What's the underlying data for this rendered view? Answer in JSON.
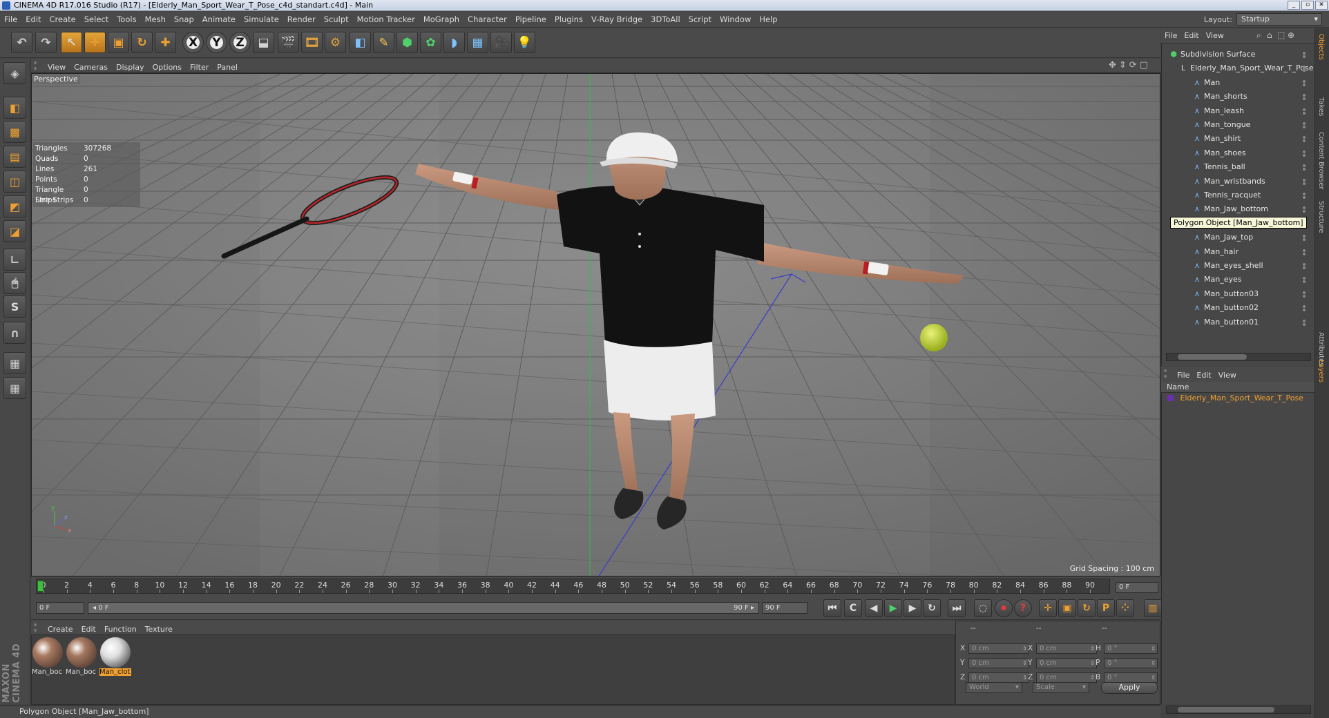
{
  "window": {
    "title": "CINEMA 4D R17.016 Studio (R17) - [Elderly_Man_Sport_Wear_T_Pose_c4d_standart.c4d] - Main",
    "controls": [
      "_",
      "▫",
      "✕"
    ]
  },
  "menu": [
    "File",
    "Edit",
    "Create",
    "Select",
    "Tools",
    "Mesh",
    "Snap",
    "Animate",
    "Simulate",
    "Render",
    "Sculpt",
    "Motion Tracker",
    "MoGraph",
    "Character",
    "Pipeline",
    "Plugins",
    "V-Ray Bridge",
    "3DToAll",
    "Script",
    "Window",
    "Help"
  ],
  "layout": {
    "label": "Layout:",
    "value": "Startup"
  },
  "toolbar": [
    {
      "name": "undo-icon",
      "glyph": "↶"
    },
    {
      "name": "redo-icon",
      "glyph": "↷"
    },
    {
      "name": "live-select-icon",
      "glyph": "↖",
      "active": true
    },
    {
      "name": "move-icon",
      "glyph": "✛",
      "active": true
    },
    {
      "name": "scale-icon",
      "glyph": "▣"
    },
    {
      "name": "rotate-icon",
      "glyph": "↻"
    },
    {
      "name": "last-tool-icon",
      "glyph": "✚"
    },
    {
      "name": "x-axis-icon",
      "glyph": "X"
    },
    {
      "name": "y-axis-icon",
      "glyph": "Y"
    },
    {
      "name": "z-axis-icon",
      "glyph": "Z"
    },
    {
      "name": "coordinate-system-icon",
      "glyph": "⬓"
    },
    {
      "name": "render-view-icon",
      "glyph": "🎬"
    },
    {
      "name": "render-picture-viewer-icon",
      "glyph": "🎞"
    },
    {
      "name": "render-settings-icon",
      "glyph": "⚙"
    },
    {
      "name": "cube-icon",
      "glyph": "◧"
    },
    {
      "name": "spline-pen-icon",
      "glyph": "✎"
    },
    {
      "name": "subdivision-icon",
      "glyph": "⬢"
    },
    {
      "name": "cloner-icon",
      "glyph": "✿"
    },
    {
      "name": "deformer-icon",
      "glyph": "◗"
    },
    {
      "name": "floor-icon",
      "glyph": "▦"
    },
    {
      "name": "camera-icon",
      "glyph": "🎥"
    },
    {
      "name": "light-icon",
      "glyph": "💡"
    }
  ],
  "lefttools": [
    {
      "name": "make-editable-icon",
      "glyph": "◈"
    },
    {
      "name": "model-mode-icon",
      "glyph": "◧"
    },
    {
      "name": "texture-mode-icon",
      "glyph": "▩"
    },
    {
      "name": "workplane-icon",
      "glyph": "▤"
    },
    {
      "name": "points-mode-icon",
      "glyph": "◫"
    },
    {
      "name": "edges-mode-icon",
      "glyph": "◩"
    },
    {
      "name": "polygons-mode-icon",
      "glyph": "◪"
    },
    {
      "name": "axis-mode-icon",
      "glyph": "∟"
    },
    {
      "name": "tweak-mode-icon",
      "glyph": "🖱"
    },
    {
      "name": "solo-icon",
      "glyph": "S"
    },
    {
      "name": "snap-icon",
      "glyph": "∩"
    },
    {
      "name": "workplane-lock-icon",
      "glyph": "▦"
    },
    {
      "name": "quantize-icon",
      "glyph": "▦"
    }
  ],
  "brand": "MAXON CINEMA 4D",
  "viewport": {
    "menu": [
      "View",
      "Cameras",
      "Display",
      "Options",
      "Filter",
      "Panel"
    ],
    "label": "Perspective",
    "stats": [
      {
        "k": "Triangles",
        "v": "307268"
      },
      {
        "k": "Quads",
        "v": "0"
      },
      {
        "k": "Lines",
        "v": "261"
      },
      {
        "k": "Points",
        "v": "0"
      },
      {
        "k": "Triangle Strips",
        "v": "0"
      },
      {
        "k": "Line Strips",
        "v": "0"
      }
    ],
    "grid_spacing": "Grid Spacing : 100 cm",
    "tooltip": "Polygon Object [Man_Jaw_bottom]"
  },
  "timeline": {
    "ticks": [
      "0",
      "2",
      "4",
      "6",
      "8",
      "10",
      "12",
      "14",
      "16",
      "18",
      "20",
      "22",
      "24",
      "26",
      "28",
      "30",
      "32",
      "34",
      "36",
      "38",
      "40",
      "42",
      "44",
      "46",
      "48",
      "50",
      "52",
      "54",
      "56",
      "58",
      "60",
      "62",
      "64",
      "66",
      "68",
      "70",
      "72",
      "74",
      "76",
      "78",
      "80",
      "82",
      "84",
      "86",
      "88",
      "90"
    ],
    "current": "0 F",
    "end": "0 F"
  },
  "transport": {
    "start_field": "0 F",
    "range_start": "◂ 0 F",
    "range_end": "90 F ▸",
    "end_field": "90 F",
    "buttons": [
      {
        "name": "go-to-start-icon",
        "glyph": "⏮"
      },
      {
        "name": "previous-key-icon",
        "glyph": "C"
      },
      {
        "name": "step-back-icon",
        "glyph": "◀"
      },
      {
        "name": "play-icon",
        "glyph": "▶"
      },
      {
        "name": "step-forward-icon",
        "glyph": "▶"
      },
      {
        "name": "next-key-icon",
        "glyph": "↻"
      },
      {
        "name": "go-to-end-icon",
        "glyph": "⏭"
      },
      {
        "name": "record-icon",
        "glyph": "◌"
      },
      {
        "name": "autokey-icon",
        "glyph": "⏺"
      },
      {
        "name": "keyframe-help-icon",
        "glyph": "?"
      },
      {
        "name": "key-position-icon",
        "glyph": "✛"
      },
      {
        "name": "key-scale-icon",
        "glyph": "▣"
      },
      {
        "name": "key-rotation-icon",
        "glyph": "↻"
      },
      {
        "name": "key-parameter-icon",
        "glyph": "P"
      },
      {
        "name": "key-pla-icon",
        "glyph": "⁘"
      },
      {
        "name": "timeline-layout-icon",
        "glyph": "▥"
      }
    ]
  },
  "materials": {
    "menu": [
      "Create",
      "Edit",
      "Function",
      "Texture"
    ],
    "items": [
      {
        "label": "Man_boc",
        "color": "#a97a62"
      },
      {
        "label": "Man_boc",
        "color": "#a57860"
      },
      {
        "label": "Man_clot",
        "color": "#e8e8e8",
        "selected": true
      }
    ]
  },
  "coordinates": {
    "headers": [
      "--",
      "--",
      "--"
    ],
    "rows": [
      {
        "a": "X",
        "av": "0 cm",
        "b": "X",
        "bv": "0 cm",
        "c": "H",
        "cv": "0 °"
      },
      {
        "a": "Y",
        "av": "0 cm",
        "b": "Y",
        "bv": "0 cm",
        "c": "P",
        "cv": "0 °"
      },
      {
        "a": "Z",
        "av": "0 cm",
        "b": "Z",
        "bv": "0 cm",
        "c": "B",
        "cv": "0 °"
      }
    ],
    "world": "World",
    "scale": "Scale",
    "apply": "Apply"
  },
  "status": "Polygon Object [Man_Jaw_bottom]",
  "objects": {
    "menu": [
      "File",
      "Edit",
      "View"
    ],
    "items": [
      {
        "label": "Subdivision Surface",
        "indent": 0,
        "kind": "subdivision"
      },
      {
        "label": "Elderly_Man_Sport_Wear_T_Pose",
        "indent": 1,
        "kind": "null"
      },
      {
        "label": "Man",
        "indent": 2,
        "kind": "poly"
      },
      {
        "label": "Man_shorts",
        "indent": 2,
        "kind": "poly"
      },
      {
        "label": "Man_leash",
        "indent": 2,
        "kind": "poly"
      },
      {
        "label": "Man_tongue",
        "indent": 2,
        "kind": "poly"
      },
      {
        "label": "Man_shirt",
        "indent": 2,
        "kind": "poly"
      },
      {
        "label": "Man_shoes",
        "indent": 2,
        "kind": "poly"
      },
      {
        "label": "Tennis_ball",
        "indent": 2,
        "kind": "poly"
      },
      {
        "label": "Man_wristbands",
        "indent": 2,
        "kind": "poly"
      },
      {
        "label": "Tennis_racquet",
        "indent": 2,
        "kind": "poly"
      },
      {
        "label": "Man_Jaw_bottom",
        "indent": 2,
        "kind": "poly"
      },
      {
        "label": "",
        "indent": 2,
        "kind": "poly"
      },
      {
        "label": "Man_Jaw_top",
        "indent": 2,
        "kind": "poly"
      },
      {
        "label": "Man_hair",
        "indent": 2,
        "kind": "poly"
      },
      {
        "label": "Man_eyes_shell",
        "indent": 2,
        "kind": "poly"
      },
      {
        "label": "Man_eyes",
        "indent": 2,
        "kind": "poly"
      },
      {
        "label": "Man_button03",
        "indent": 2,
        "kind": "poly"
      },
      {
        "label": "Man_button02",
        "indent": 2,
        "kind": "poly"
      },
      {
        "label": "Man_button01",
        "indent": 2,
        "kind": "poly"
      }
    ]
  },
  "layers": {
    "menu": [
      "File",
      "Edit",
      "View"
    ],
    "header": "Name",
    "item": "Elderly_Man_Sport_Wear_T_Pose"
  },
  "sidetabs": [
    {
      "label": "Objects",
      "on": true
    },
    {
      "label": "Takes",
      "on": false
    },
    {
      "label": "Content Browser",
      "on": false
    },
    {
      "label": "Structure",
      "on": false
    },
    {
      "label": "Attributes",
      "on": false
    },
    {
      "label": "Layers",
      "on": true
    }
  ]
}
